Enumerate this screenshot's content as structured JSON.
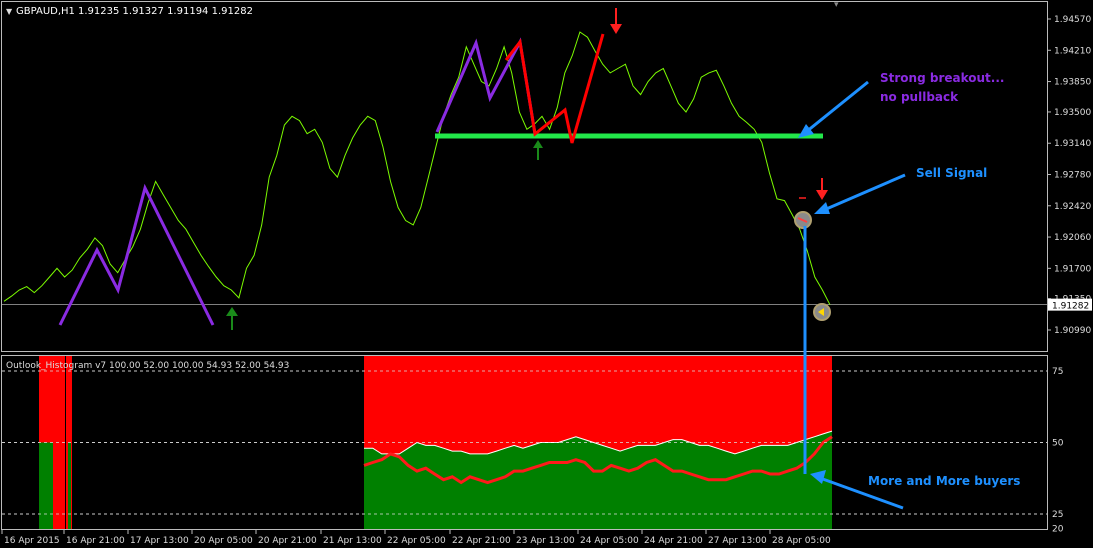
{
  "chart_data": [
    {
      "type": "line",
      "symbol": "GBPAUD,H1",
      "ohlc": "1.91235 1.91327 1.91194 1.91282",
      "y_ticks": [
        "1.94570",
        "1.94210",
        "1.93850",
        "1.93500",
        "1.93140",
        "1.92780",
        "1.92420",
        "1.92060",
        "1.91700",
        "1.91350",
        "1.90990"
      ],
      "current_price": "1.91282",
      "price_series": [
        1.9132,
        1.9138,
        1.9145,
        1.9149,
        1.9142,
        1.915,
        1.916,
        1.917,
        1.916,
        1.9168,
        1.9182,
        1.9192,
        1.9205,
        1.9196,
        1.9175,
        1.9165,
        1.918,
        1.9195,
        1.9215,
        1.9245,
        1.927,
        1.9255,
        1.924,
        1.9225,
        1.9215,
        1.92,
        1.9185,
        1.9172,
        1.916,
        1.915,
        1.9145,
        1.9136,
        1.917,
        1.9185,
        1.922,
        1.9275,
        1.93,
        1.9335,
        1.9345,
        1.934,
        1.9325,
        1.933,
        1.9315,
        1.9285,
        1.9275,
        1.93,
        1.932,
        1.9335,
        1.9345,
        1.934,
        1.931,
        1.927,
        1.924,
        1.9225,
        1.922,
        1.924,
        1.9275,
        1.931,
        1.9345,
        1.937,
        1.939,
        1.9425,
        1.9405,
        1.9385,
        1.938,
        1.94,
        1.9425,
        1.9395,
        1.935,
        1.933,
        1.9336,
        1.9345,
        1.933,
        1.9355,
        1.9395,
        1.9415,
        1.9442,
        1.9436,
        1.942,
        1.9405,
        1.9395,
        1.94,
        1.9405,
        1.938,
        1.937,
        1.9385,
        1.9395,
        1.94,
        1.938,
        1.936,
        1.935,
        1.9365,
        1.939,
        1.9395,
        1.9398,
        1.938,
        1.936,
        1.9345,
        1.9338,
        1.933,
        1.9315,
        1.928,
        1.925,
        1.9248,
        1.9232,
        1.9215,
        1.919,
        1.916,
        1.9145,
        1.9128
      ],
      "x_tick_labels": [
        "16 Apr 2015",
        "16 Apr 21:00",
        "17 Apr 13:00",
        "20 Apr 05:00",
        "20 Apr 21:00",
        "21 Apr 13:00",
        "22 Apr 05:00",
        "22 Apr 21:00",
        "23 Apr 13:00",
        "24 Apr 05:00",
        "24 Apr 21:00",
        "27 Apr 13:00",
        "28 Apr 05:00"
      ]
    },
    {
      "type": "area",
      "indicator_label": "Outlook_Histogram v7 100.00 52.00 100.00 54.93 52.00 54.93",
      "y_ticks": [
        "75",
        "50",
        "25",
        "20"
      ],
      "levels": [
        75,
        50,
        25
      ],
      "series": [
        {
          "values": [
            48,
            48,
            46,
            46,
            46,
            48,
            50,
            49,
            49,
            48,
            47,
            47,
            46,
            46,
            46,
            47,
            48,
            49,
            48,
            49,
            50,
            50,
            50,
            51,
            52,
            51,
            50,
            49,
            48,
            47,
            48,
            49,
            49,
            49,
            50,
            51,
            51,
            50,
            49,
            49,
            48,
            47,
            46,
            47,
            48,
            49,
            49,
            49,
            49,
            50,
            51,
            52,
            53,
            54
          ]
        },
        {
          "values": [
            42,
            43,
            44,
            46,
            45,
            42,
            40,
            41,
            39,
            37,
            38,
            36,
            38,
            37,
            36,
            37,
            38,
            40,
            40,
            41,
            42,
            43,
            43,
            43,
            44,
            43,
            40,
            40,
            42,
            41,
            40,
            41,
            43,
            44,
            42,
            40,
            40,
            39,
            38,
            37,
            37,
            37,
            38,
            39,
            40,
            40,
            39,
            39,
            40,
            41,
            43,
            46,
            50,
            52
          ]
        }
      ]
    }
  ],
  "annotations": {
    "strong_breakout_line1": "Strong breakout...",
    "strong_breakout_line2": "no pullback",
    "sell_signal": "Sell Signal",
    "more_buyers": "More and More buyers"
  },
  "colors": {
    "price_line": "#7CFC00",
    "zigzag": "#8A2BE2",
    "zigzag_down": "#FF0000",
    "support_line": "#22E84A",
    "histogram_red": "#FF0000",
    "histogram_green": "#008000",
    "annotation_blue": "#1E90FF",
    "annotation_purple": "#8A2BE2",
    "signal_line": "#FF1A1A"
  }
}
